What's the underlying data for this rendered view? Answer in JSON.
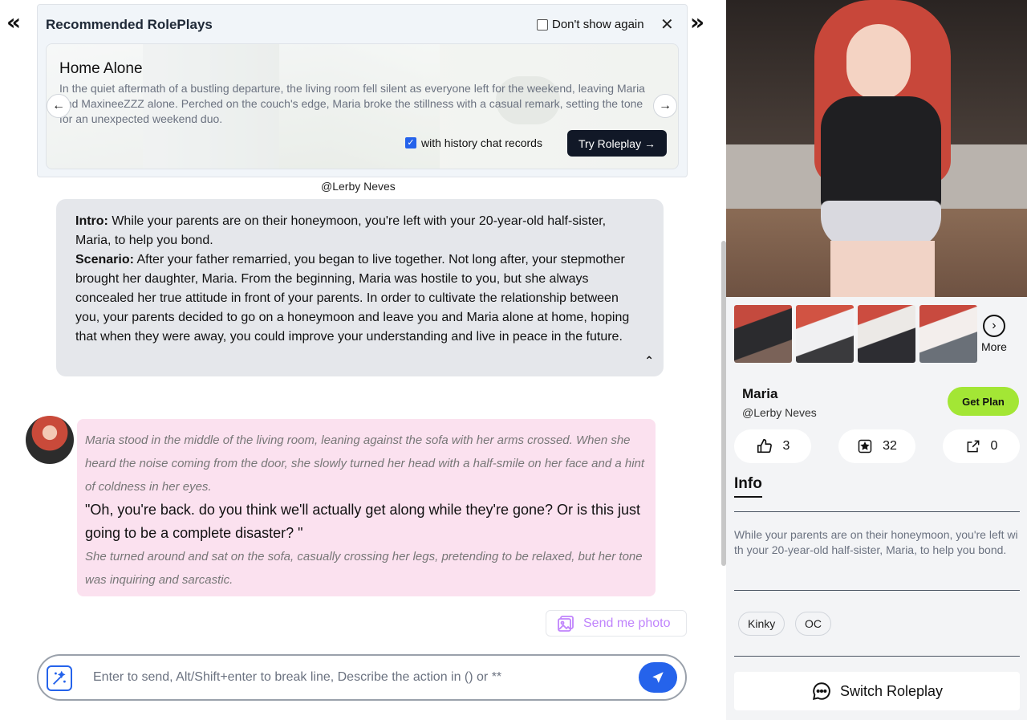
{
  "nav": {
    "collapse_left": "«",
    "collapse_right": "»"
  },
  "recommended": {
    "title": "Recommended RolePlays",
    "dont_show_label": "Don't show again",
    "close_label": "✕",
    "card": {
      "name": "Home Alone",
      "description": "In the quiet aftermath of a bustling departure, the living room fell silent as everyone left for the weekend, leaving Maria and MaxineeZZZ alone. Perched on the couch's edge, Maria broke the stillness with a casual remark, setting the tone for an unexpected weekend duo.",
      "history_label": "with history chat records",
      "history_checked": true,
      "try_label": "Try Roleplay →"
    },
    "author": "@Lerby Neves"
  },
  "intro": {
    "intro_label": "Intro:",
    "intro_text": " While your parents are on their honeymoon, you're left with your 20-year-old half-sister, Maria, to help you bond.",
    "scenario_label": "Scenario:",
    "scenario_text": " After your father remarried, you began to live together. Not long after, your stepmother brought her daughter, Maria. From the beginning, Maria was hostile to you, but she always concealed her true attitude in front of your parents. In order to cultivate the relationship between you, your parents decided to go on a honeymoon and leave you and Maria alone at home, hoping that when they were away, you could improve your understanding and live in peace in the future.",
    "collapse_icon": "⌃"
  },
  "message": {
    "action1": "Maria stood in the middle of the living room, leaning against the sofa with her arms crossed. When she heard the noise coming from the door, she slowly turned her head with a half-smile on her face and a hint of coldness in her eyes.",
    "quote": "\"Oh, you're back. do you think we'll actually get along while they're gone? Or is this just going to be a complete disaster? \"",
    "action2": "She turned around and sat on the sofa, casually crossing her legs, pretending to be relaxed, but her tone was inquiring and sarcastic."
  },
  "send_photo_label": "Send me photo",
  "composer": {
    "placeholder": "Enter to send, Alt/Shift+enter to break line, Describe the action in () or **"
  },
  "profile": {
    "more_label": "More",
    "name": "Maria",
    "author": "@Lerby Neves",
    "plan_label": "Get Plan",
    "likes": "3",
    "favorites": "32",
    "shares": "0",
    "info_tab": "Info",
    "info_text": "While your parents are on their honeymoon, you're left with your 20-year-old half-sister, Maria, to help you bond.",
    "tags": [
      "Kinky",
      "OC"
    ],
    "switch_label": "Switch Roleplay"
  },
  "colors": {
    "accent": "#2563eb",
    "plan": "#a3e635",
    "bubble": "#fbe1ef",
    "dark_button": "#111827"
  }
}
